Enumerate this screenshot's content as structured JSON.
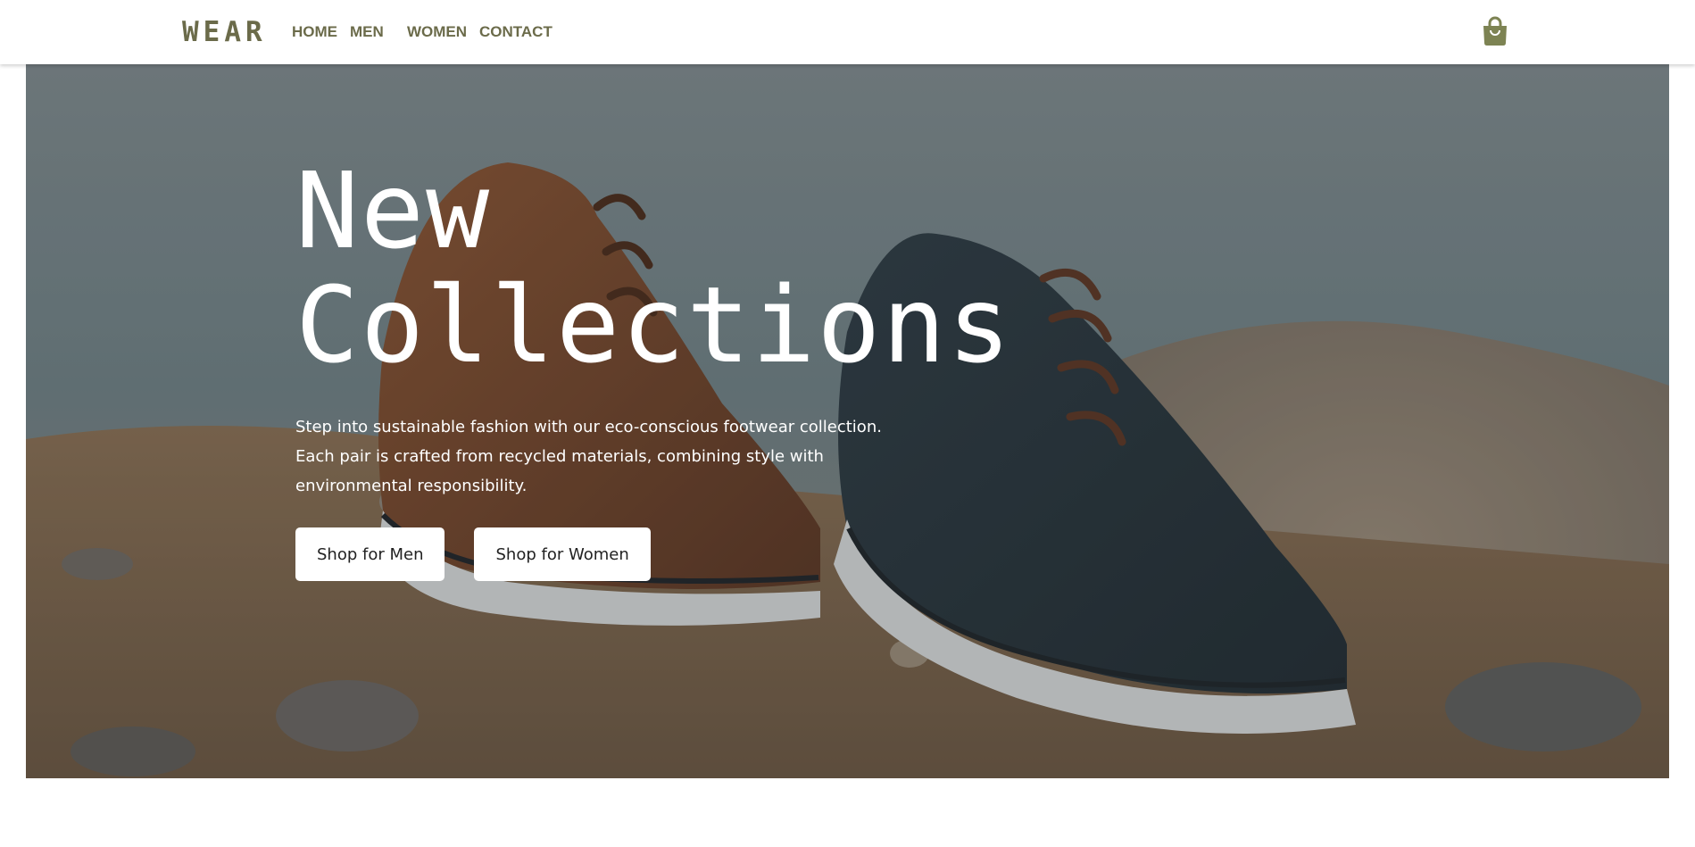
{
  "brand": {
    "logo": "WEAR"
  },
  "nav": {
    "items": [
      {
        "label": "HOME"
      },
      {
        "label": "MEN"
      },
      {
        "label": "WOMEN"
      },
      {
        "label": "CONTACT"
      }
    ]
  },
  "cart": {
    "icon": "shopping-bag-icon"
  },
  "hero": {
    "title_line1": "New",
    "title_line2": "Collections",
    "description": "Step into sustainable fashion with our eco-conscious footwear collection. Each pair is crafted from recycled materials, combining style with environmental responsibility.",
    "buttons": {
      "men": "Shop for Men",
      "women": "Shop for Women"
    }
  },
  "colors": {
    "brand": "#6b6b4a",
    "cart_icon": "#7d8353",
    "button_bg": "#ffffff",
    "hero_text": "#ffffff"
  }
}
